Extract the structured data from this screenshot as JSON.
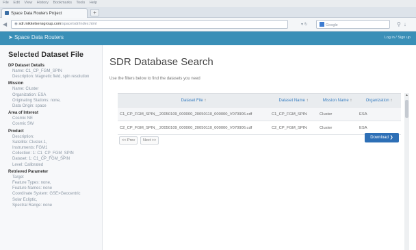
{
  "browser": {
    "menu": [
      "File",
      "Edit",
      "View",
      "History",
      "Bookmarks",
      "Tools",
      "Help"
    ],
    "tab_title": "Space Data Routers Project",
    "new_tab": "+",
    "url": "sdr.mikkelsensgroup.com/space/sdr/index.html",
    "url_host": "sdr.mikkelsensgroup.com",
    "url_path": "/space/sdr/index.html",
    "search_engine": "Google",
    "icons": {
      "back": "left-arrow-icon",
      "search": "magnifier-icon",
      "download": "down-arrow-icon"
    }
  },
  "header": {
    "brand": "Space Data Routers",
    "login": "Log in / Sign up"
  },
  "sidebar": {
    "title": "Selected Dataset File",
    "sections": [
      {
        "heading": "DP Dataset Details",
        "items": [
          "Name: C1_CP_FGM_SPIN",
          "Description: Magnetic field, spin resolution"
        ]
      },
      {
        "heading": "Mission",
        "items": [
          "Name: Cluster",
          "Organization: ESA",
          "Originating Stations: none,",
          "Data Origin: space"
        ]
      },
      {
        "heading": "Area of Interest",
        "items": [
          "Cosmic NE",
          "Cosmic SW"
        ]
      },
      {
        "heading": "Product",
        "items": [
          "Description:",
          "Satellite: Cluster-1,",
          "Instruments: FGM1",
          "Collection: 1: C1_CP_FGM_SPIN",
          "Dataset: 1: C1_CP_FGM_SPIN",
          "Level: Calibrated"
        ]
      },
      {
        "heading": "Retrieved Parameter",
        "items": [
          "Target",
          "Feature Types: none,",
          "Feature Names: none",
          "Coordinate System: GSE>Geocentric",
          "Solar Ecliptic,",
          "Spectral Range: none"
        ]
      }
    ]
  },
  "main": {
    "title": "SDR Database Search",
    "instructions": "Use the filters below to find the datasets you need",
    "table": {
      "columns": [
        "Dataset File",
        "Dataset Name",
        "Mission Name",
        "Organization"
      ],
      "rows": [
        [
          "C1_CP_FGM_SPIN__20050109_000000_20050110_000000_V070906.cdf",
          "C1_CP_FGM_SPIN",
          "Cluster",
          "ESA"
        ],
        [
          "C2_CP_FGM_SPIN__20050109_000000_20050110_000000_V070906.cdf",
          "C2_CP_FGM_SPIN",
          "Cluster",
          "ESA"
        ]
      ]
    },
    "pager": {
      "prev": "<< Prev",
      "next": "Next >>"
    },
    "download_label": "Download"
  },
  "colors": {
    "header": "#3a8fb7",
    "link": "#3a7fc1",
    "download": "#2d6fb6"
  }
}
